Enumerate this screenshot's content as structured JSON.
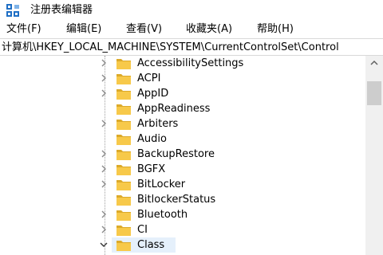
{
  "window": {
    "title": "注册表编辑器",
    "icon": "registry-editor-icon"
  },
  "menubar": {
    "items": [
      {
        "label": "文件(F)"
      },
      {
        "label": "编辑(E)"
      },
      {
        "label": "查看(V)"
      },
      {
        "label": "收藏夹(A)"
      },
      {
        "label": "帮助(H)"
      }
    ]
  },
  "address": {
    "path": "计算机\\HKEY_LOCAL_MACHINE\\SYSTEM\\CurrentControlSet\\Control"
  },
  "tree": {
    "items": [
      {
        "label": "AccessibilitySettings",
        "expander": "collapsed"
      },
      {
        "label": "ACPI",
        "expander": "collapsed"
      },
      {
        "label": "AppID",
        "expander": "collapsed"
      },
      {
        "label": "AppReadiness",
        "expander": "none"
      },
      {
        "label": "Arbiters",
        "expander": "collapsed"
      },
      {
        "label": "Audio",
        "expander": "none"
      },
      {
        "label": "BackupRestore",
        "expander": "collapsed"
      },
      {
        "label": "BGFX",
        "expander": "collapsed"
      },
      {
        "label": "BitLocker",
        "expander": "collapsed"
      },
      {
        "label": "BitlockerStatus",
        "expander": "none"
      },
      {
        "label": "Bluetooth",
        "expander": "collapsed"
      },
      {
        "label": "CI",
        "expander": "collapsed"
      },
      {
        "label": "Class",
        "expander": "expanded",
        "selected": true
      }
    ]
  },
  "colors": {
    "folder": "#f7c94a",
    "folder_dark": "#dcaa2a",
    "selection": "#e5f0fb",
    "scrollbar_track": "#f0f0f0",
    "scrollbar_thumb": "#cdcdcd"
  }
}
